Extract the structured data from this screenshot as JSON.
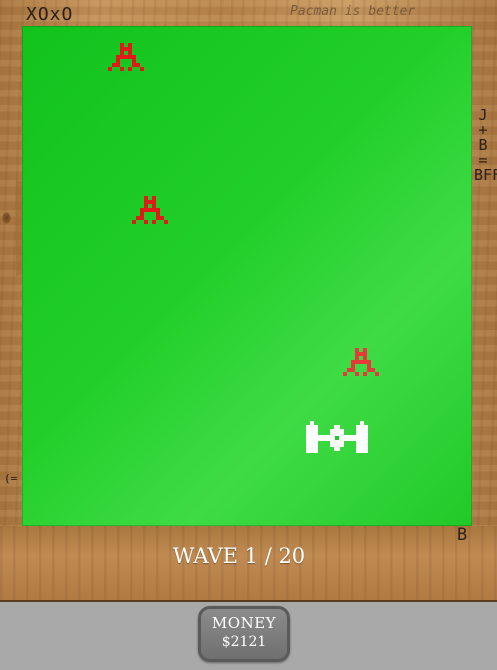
{
  "scribbles": {
    "score": "XOxO",
    "pacman": "Pacman is better",
    "jb": "J\n+\nB\n=\nBFF",
    "paren": "(=",
    "b": "B"
  },
  "hud": {
    "wave_text": "WAVE 1 / 20",
    "money_label": "MONEY",
    "money_value": "$2121"
  },
  "colors": {
    "enemy": "#e11919",
    "player": "#ffffff",
    "board": "#1dc826"
  },
  "entities": {
    "enemies": [
      "red-alien-invader",
      "red-alien-invader",
      "red-alien-invader"
    ],
    "player": "white-tie-fighter-ship"
  }
}
